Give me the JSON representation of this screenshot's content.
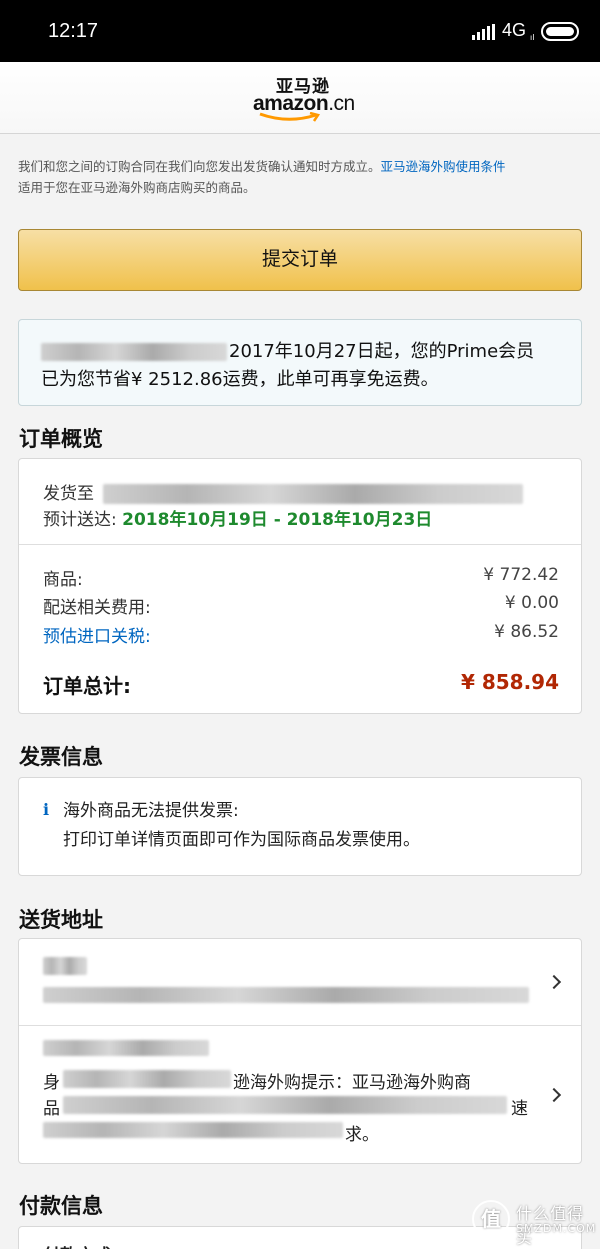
{
  "status_bar": {
    "time": "12:17",
    "network": "4G",
    "network_sub": "ıl"
  },
  "header": {
    "logo_cn": "亚马逊",
    "logo_en": "amazon",
    "logo_suffix": ".cn"
  },
  "notice": {
    "text": "我们和您之间的订购合同在我们向您发出发货确认通知时方成立。",
    "link": "亚马逊海外购使用条件",
    "tail": "适用于您在亚马逊海外购商店购买的商品。"
  },
  "submit_button": {
    "label": "提交订单"
  },
  "prime": {
    "line1": "2017年10月27日起，您的Prime会员",
    "line2": "已为您节省¥ 2512.86运费，此单可再享免运费。"
  },
  "order_summary": {
    "title": "订单概览",
    "ship_to_label": "发货至",
    "eta_label": "预计送达:",
    "eta_value": "2018年10月19日 - 2018年10月23日",
    "rows": [
      {
        "label": "商品:",
        "value": "¥ 772.42"
      },
      {
        "label": "配送相关费用:",
        "value": "¥ 0.00"
      },
      {
        "label": "预估进口关税:",
        "value": "¥ 86.52"
      }
    ],
    "total_label": "订单总计:",
    "total_value": "¥ 858.94"
  },
  "invoice": {
    "title": "发票信息",
    "icon": "i",
    "line1": "海外商品无法提供发票:",
    "line2": "打印订单详情页面即可作为国际商品发票使用。"
  },
  "shipping_address": {
    "title": "送货地址",
    "reminder_prefix": "身",
    "reminder_middle": "逊海外购提示：亚马逊海外购商",
    "reminder_line2_prefix": "品",
    "reminder_line2_end": "速",
    "reminder_line3_end": "求。"
  },
  "payment": {
    "title": "付款信息",
    "method_label": "付款方式"
  },
  "watermark": {
    "logo": "值",
    "cn": "什么值得买",
    "en": "SMZDM.COM"
  },
  "colors": {
    "accent_link": "#0066c0",
    "delivery_green": "#1e8a2e",
    "total_red": "#b12704",
    "button_gold": "#f0c14b"
  }
}
